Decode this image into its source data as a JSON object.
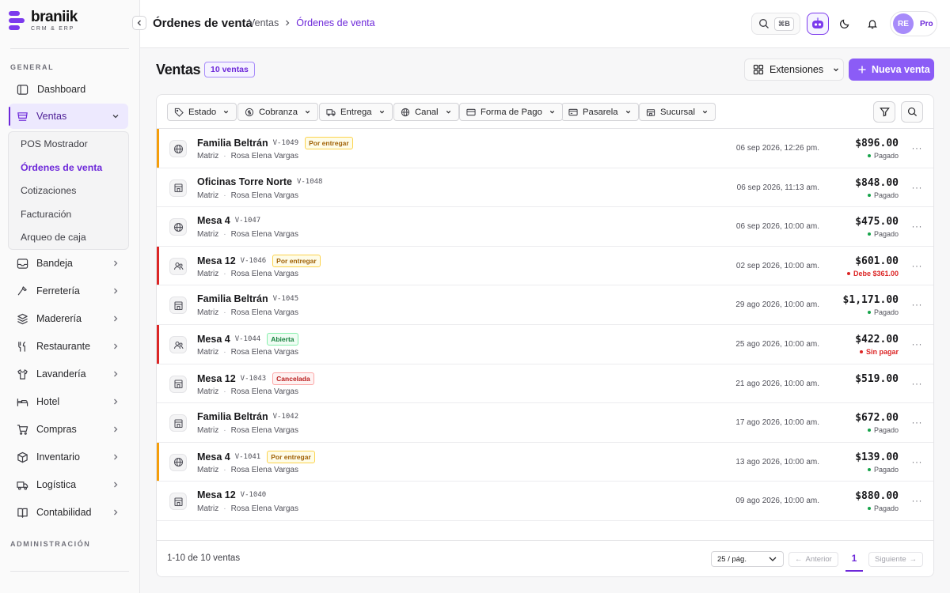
{
  "brand": {
    "name": "braniik",
    "subtitle": "CRM & ERP"
  },
  "sidebar": {
    "general_label": "GENERAL",
    "admin_label": "ADMINISTRACIÓN",
    "dashboard": "Dashboard",
    "ventas": "Ventas",
    "submenu": [
      "POS Mostrador",
      "Órdenes de venta",
      "Cotizaciones",
      "Facturación",
      "Arqueo de caja"
    ],
    "items": [
      {
        "label": "Bandeja",
        "icon": "inbox-icon"
      },
      {
        "label": "Ferretería",
        "icon": "hammer-icon"
      },
      {
        "label": "Maderería",
        "icon": "layers-icon"
      },
      {
        "label": "Restaurante",
        "icon": "utensils-icon"
      },
      {
        "label": "Lavandería",
        "icon": "shirt-icon"
      },
      {
        "label": "Hotel",
        "icon": "bed-icon"
      },
      {
        "label": "Compras",
        "icon": "cart-icon"
      },
      {
        "label": "Inventario",
        "icon": "box-icon"
      },
      {
        "label": "Logística",
        "icon": "truck-icon"
      },
      {
        "label": "Contabilidad",
        "icon": "book-icon"
      }
    ]
  },
  "topbar": {
    "title": "Órdenes de venta",
    "crumb_parent": "Ventas",
    "crumb_current": "Órdenes de venta",
    "search_kbd": "⌘B",
    "avatar_initials": "RE",
    "plan": "Pro"
  },
  "header": {
    "title": "Ventas",
    "count_badge": "10 ventas",
    "extensions": "Extensiones",
    "new_sale": "Nueva venta"
  },
  "filters": [
    "Estado",
    "Cobranza",
    "Entrega",
    "Canal",
    "Forma de Pago",
    "Pasarela",
    "Sucursal"
  ],
  "sales": [
    {
      "customer": "Familia Beltrán",
      "folio": "V-1049",
      "badge": "Por entregar",
      "badge_type": "entregar",
      "channel": "web",
      "branch": "Matriz",
      "seller": "Rosa Elena Vargas",
      "date": "06 sep 2026, 12:26 pm.",
      "amount": "$896.00",
      "payment": "Pagado",
      "payment_type": "paid",
      "accent": "#f59e0b"
    },
    {
      "customer": "Oficinas Torre Norte",
      "folio": "V-1048",
      "badge": "",
      "badge_type": "",
      "channel": "store",
      "branch": "Matriz",
      "seller": "Rosa Elena Vargas",
      "date": "06 sep 2026, 11:13 am.",
      "amount": "$848.00",
      "payment": "Pagado",
      "payment_type": "paid",
      "accent": ""
    },
    {
      "customer": "Mesa 4",
      "folio": "V-1047",
      "badge": "",
      "badge_type": "",
      "channel": "web",
      "branch": "Matriz",
      "seller": "Rosa Elena Vargas",
      "date": "06 sep 2026, 10:00 am.",
      "amount": "$475.00",
      "payment": "Pagado",
      "payment_type": "paid",
      "accent": ""
    },
    {
      "customer": "Mesa 12",
      "folio": "V-1046",
      "badge": "Por entregar",
      "badge_type": "entregar",
      "channel": "person",
      "branch": "Matriz",
      "seller": "Rosa Elena Vargas",
      "date": "02 sep 2026, 10:00 am.",
      "amount": "$601.00",
      "payment": "Debe $361.00",
      "payment_type": "debt",
      "accent": "#dc2626"
    },
    {
      "customer": "Familia Beltrán",
      "folio": "V-1045",
      "badge": "",
      "badge_type": "",
      "channel": "store",
      "branch": "Matriz",
      "seller": "Rosa Elena Vargas",
      "date": "29 ago 2026, 10:00 am.",
      "amount": "$1,171.00",
      "payment": "Pagado",
      "payment_type": "paid",
      "accent": ""
    },
    {
      "customer": "Mesa 4",
      "folio": "V-1044",
      "badge": "Abierta",
      "badge_type": "abierta",
      "channel": "person",
      "branch": "Matriz",
      "seller": "Rosa Elena Vargas",
      "date": "25 ago 2026, 10:00 am.",
      "amount": "$422.00",
      "payment": "Sin pagar",
      "payment_type": "debt",
      "accent": "#dc2626"
    },
    {
      "customer": "Mesa 12",
      "folio": "V-1043",
      "badge": "Cancelada",
      "badge_type": "cancelada",
      "channel": "store",
      "branch": "Matriz",
      "seller": "Rosa Elena Vargas",
      "date": "21 ago 2026, 10:00 am.",
      "amount": "$519.00",
      "payment": "",
      "payment_type": "",
      "accent": ""
    },
    {
      "customer": "Familia Beltrán",
      "folio": "V-1042",
      "badge": "",
      "badge_type": "",
      "channel": "store",
      "branch": "Matriz",
      "seller": "Rosa Elena Vargas",
      "date": "17 ago 2026, 10:00 am.",
      "amount": "$672.00",
      "payment": "Pagado",
      "payment_type": "paid",
      "accent": ""
    },
    {
      "customer": "Mesa 4",
      "folio": "V-1041",
      "badge": "Por entregar",
      "badge_type": "entregar",
      "channel": "web",
      "branch": "Matriz",
      "seller": "Rosa Elena Vargas",
      "date": "13 ago 2026, 10:00 am.",
      "amount": "$139.00",
      "payment": "Pagado",
      "payment_type": "paid",
      "accent": "#f59e0b"
    },
    {
      "customer": "Mesa 12",
      "folio": "V-1040",
      "badge": "",
      "badge_type": "",
      "channel": "store",
      "branch": "Matriz",
      "seller": "Rosa Elena Vargas",
      "date": "09 ago 2026, 10:00 am.",
      "amount": "$880.00",
      "payment": "Pagado",
      "payment_type": "paid",
      "accent": ""
    }
  ],
  "footer": {
    "count": "1-10 de 10 ventas",
    "per_page": "25 / pág.",
    "prev": "Anterior",
    "page": "1",
    "next": "Siguiente"
  },
  "colors": {
    "accent": "#6d28d9",
    "paid": "#16a34a",
    "debt": "#dc2626"
  }
}
